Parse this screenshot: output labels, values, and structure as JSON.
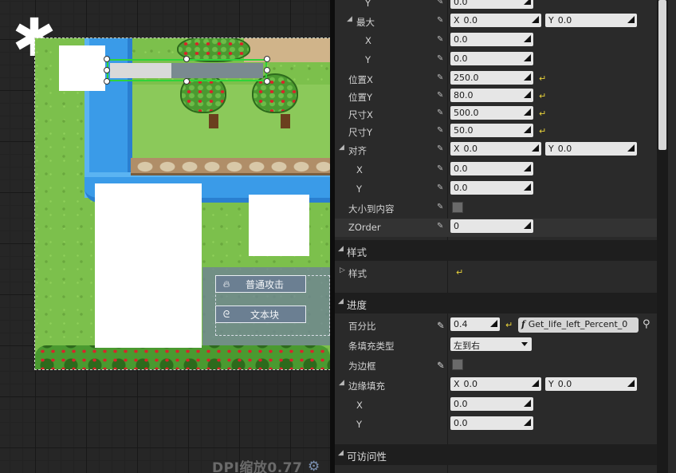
{
  "designer": {
    "buttons": [
      {
        "icon": "fire-icon",
        "label": "普通攻击"
      },
      {
        "icon": "swirl-icon",
        "label": "文本块"
      }
    ],
    "progress_percent": 0.4,
    "dpi_label": "DPI缩放0.77"
  },
  "details": {
    "rows": [
      {
        "label": "Y",
        "indent": 2,
        "kind": "field",
        "value": "0.0"
      },
      {
        "label": "最大",
        "indent": 1,
        "kind": "xy",
        "x": "0.0",
        "y": "0.0",
        "expanded": true
      },
      {
        "label": "X",
        "indent": 2,
        "kind": "field",
        "value": "0.0"
      },
      {
        "label": "Y",
        "indent": 2,
        "kind": "field",
        "value": "0.0"
      },
      {
        "label": "位置X",
        "indent": 0,
        "kind": "field",
        "value": "250.0",
        "reset": true
      },
      {
        "label": "位置Y",
        "indent": 0,
        "kind": "field",
        "value": "80.0",
        "reset": true
      },
      {
        "label": "尺寸X",
        "indent": 0,
        "kind": "field",
        "value": "500.0",
        "reset": true
      },
      {
        "label": "尺寸Y",
        "indent": 0,
        "kind": "field",
        "value": "50.0",
        "reset": true
      },
      {
        "label": "对齐",
        "indent": 0,
        "kind": "xy",
        "x": "0.0",
        "y": "0.0",
        "expanded": true
      },
      {
        "label": "X",
        "indent": 1,
        "kind": "field",
        "value": "0.0"
      },
      {
        "label": "Y",
        "indent": 1,
        "kind": "field",
        "value": "0.0"
      },
      {
        "label": "大小到内容",
        "indent": 0,
        "kind": "checkbox"
      },
      {
        "label": "ZOrder",
        "indent": 0,
        "kind": "field",
        "value": "0"
      }
    ],
    "section_style": "样式",
    "style_row": "样式",
    "section_progress": "进度",
    "percent_label": "百分比",
    "percent_value": "0.4",
    "percent_binding": "Get_life_left_Percent_0",
    "fill_type_label": "条填充类型",
    "fill_type_value": "左到右",
    "is_marquee_label": "为边框",
    "border_padding_label": "边缘填充",
    "border_padding_x": "0.0",
    "border_padding_y": "0.0",
    "x_label": "X",
    "y_label": "Y",
    "x_value": "0.0",
    "y_value": "0.0",
    "section_accessibility": "可访问性",
    "axis_x": "X",
    "axis_y": "Y"
  }
}
